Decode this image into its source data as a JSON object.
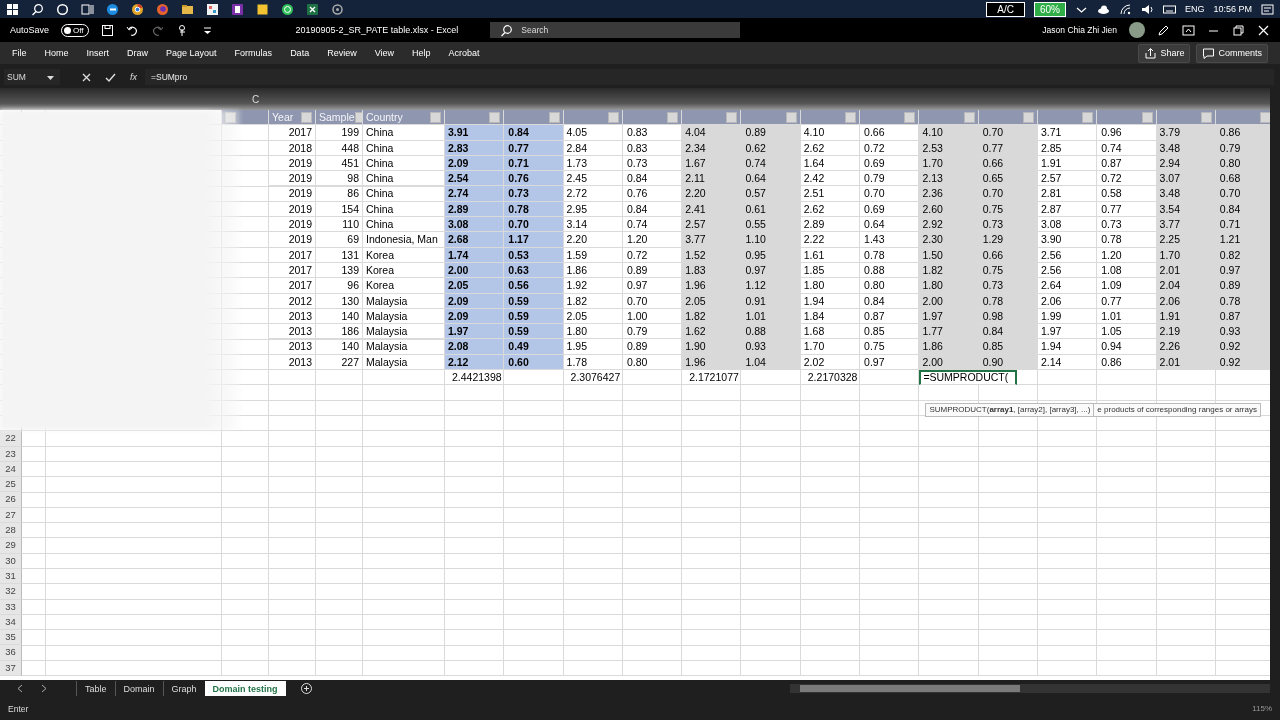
{
  "taskbar": {
    "tray": {
      "power": "A/C",
      "battery": "60%",
      "language": "ENG",
      "time": "10:56 PM"
    }
  },
  "title_bar": {
    "autosave_label": "AutoSave",
    "autosave_state": "Off",
    "autosave_on": false,
    "title": "20190905-2_SR_PATE table.xlsx  -  Excel",
    "search_placeholder": "Search",
    "user": "Jason Chia Zhi Jien"
  },
  "ribbon": {
    "tabs": [
      "File",
      "Home",
      "Insert",
      "Draw",
      "Page Layout",
      "Formulas",
      "Data",
      "Review",
      "View",
      "Help",
      "Acrobat"
    ],
    "share": "Share",
    "comments": "Comments"
  },
  "formula_bar": {
    "name_box": "SUM",
    "function_button": "fx",
    "formula": "=SUMpro"
  },
  "grid": {
    "column_letter": "C",
    "headers": [
      "Year",
      "Sample",
      "Country"
    ],
    "column_bands": [
      {
        "color": "#b4c6e7",
        "bold": true
      },
      {
        "color": "#ffffff",
        "bold": false
      },
      {
        "color": "#d9d9d9",
        "bold": false
      },
      {
        "color": "#ffffff",
        "bold": false
      },
      {
        "color": "#d9d9d9",
        "bold": false
      },
      {
        "color": "#ffffff",
        "bold": false
      },
      {
        "color": "#d9d9d9",
        "bold": false
      }
    ],
    "rows": [
      {
        "year": "2017",
        "sample": "199",
        "country": "China",
        "values": [
          "3.91",
          "0.84",
          "4.05",
          "0.83",
          "4.04",
          "0.89",
          "4.10",
          "0.66",
          "4.10",
          "0.70",
          "3.71",
          "0.96",
          "3.79",
          "0.86"
        ]
      },
      {
        "year": "2018",
        "sample": "448",
        "country": "China",
        "values": [
          "2.83",
          "0.77",
          "2.84",
          "0.83",
          "2.34",
          "0.62",
          "2.62",
          "0.72",
          "2.53",
          "0.77",
          "2.85",
          "0.74",
          "3.48",
          "0.79"
        ]
      },
      {
        "year": "2019",
        "sample": "451",
        "country": "China",
        "values": [
          "2.09",
          "0.71",
          "1.73",
          "0.73",
          "1.67",
          "0.74",
          "1.64",
          "0.69",
          "1.70",
          "0.66",
          "1.91",
          "0.87",
          "2.94",
          "0.80"
        ]
      },
      {
        "year": "2019",
        "sample": "98",
        "country": "China",
        "values": [
          "2.54",
          "0.76",
          "2.45",
          "0.84",
          "2.11",
          "0.64",
          "2.42",
          "0.79",
          "2.13",
          "0.65",
          "2.57",
          "0.72",
          "3.07",
          "0.68"
        ]
      },
      {
        "year": "2019",
        "sample": "86",
        "country": "China",
        "values": [
          "2.74",
          "0.73",
          "2.72",
          "0.76",
          "2.20",
          "0.57",
          "2.51",
          "0.70",
          "2.36",
          "0.70",
          "2.81",
          "0.58",
          "3.48",
          "0.70"
        ]
      },
      {
        "year": "2019",
        "sample": "154",
        "country": "China",
        "values": [
          "2.89",
          "0.78",
          "2.95",
          "0.84",
          "2.41",
          "0.61",
          "2.62",
          "0.69",
          "2.60",
          "0.75",
          "2.87",
          "0.77",
          "3.54",
          "0.84"
        ]
      },
      {
        "year": "2019",
        "sample": "110",
        "country": "China",
        "values": [
          "3.08",
          "0.70",
          "3.14",
          "0.74",
          "2.57",
          "0.55",
          "2.89",
          "0.64",
          "2.92",
          "0.73",
          "3.08",
          "0.73",
          "3.77",
          "0.71"
        ]
      },
      {
        "year": "2019",
        "sample": "69",
        "country": "Indonesia, Man",
        "values": [
          "2.68",
          "1.17",
          "2.20",
          "1.20",
          "3.77",
          "1.10",
          "2.22",
          "1.43",
          "2.30",
          "1.29",
          "3.90",
          "0.78",
          "2.25",
          "1.21"
        ]
      },
      {
        "year": "2017",
        "sample": "131",
        "country": "Korea",
        "values": [
          "1.74",
          "0.53",
          "1.59",
          "0.72",
          "1.52",
          "0.95",
          "1.61",
          "0.78",
          "1.50",
          "0.66",
          "2.56",
          "1.20",
          "1.70",
          "0.82"
        ]
      },
      {
        "year": "2017",
        "sample": "139",
        "country": "Korea",
        "values": [
          "2.00",
          "0.63",
          "1.86",
          "0.89",
          "1.83",
          "0.97",
          "1.85",
          "0.88",
          "1.82",
          "0.75",
          "2.56",
          "1.08",
          "2.01",
          "0.97"
        ]
      },
      {
        "year": "2017",
        "sample": "96",
        "country": "Korea",
        "values": [
          "2.05",
          "0.56",
          "1.92",
          "0.97",
          "1.96",
          "1.12",
          "1.80",
          "0.80",
          "1.80",
          "0.73",
          "2.64",
          "1.09",
          "2.04",
          "0.89"
        ]
      },
      {
        "year": "2012",
        "sample": "130",
        "country": "Malaysia",
        "values": [
          "2.09",
          "0.59",
          "1.82",
          "0.70",
          "2.05",
          "0.91",
          "1.94",
          "0.84",
          "2.00",
          "0.78",
          "2.06",
          "0.77",
          "2.06",
          "0.78"
        ]
      },
      {
        "year": "2013",
        "sample": "140",
        "country": "Malaysia",
        "values": [
          "2.09",
          "0.59",
          "2.05",
          "1.00",
          "1.82",
          "1.01",
          "1.84",
          "0.87",
          "1.97",
          "0.98",
          "1.99",
          "1.01",
          "1.91",
          "0.87"
        ]
      },
      {
        "year": "2013",
        "sample": "186",
        "country": "Malaysia",
        "values": [
          "1.97",
          "0.59",
          "1.80",
          "0.79",
          "1.62",
          "0.88",
          "1.68",
          "0.85",
          "1.77",
          "0.84",
          "1.97",
          "1.05",
          "2.19",
          "0.93"
        ]
      },
      {
        "year": "2013",
        "sample": "140",
        "country": "Malaysia",
        "values": [
          "2.08",
          "0.49",
          "1.95",
          "0.89",
          "1.90",
          "0.93",
          "1.70",
          "0.75",
          "1.86",
          "0.85",
          "1.94",
          "0.94",
          "2.26",
          "0.92"
        ]
      },
      {
        "year": "2013",
        "sample": "227",
        "country": "Malaysia",
        "values": [
          "2.12",
          "0.60",
          "1.78",
          "0.80",
          "1.96",
          "1.04",
          "2.02",
          "0.97",
          "2.00",
          "0.90",
          "2.14",
          "0.86",
          "2.01",
          "0.92"
        ]
      }
    ],
    "totals": [
      {
        "value": "2.4421398",
        "selected": false
      },
      {
        "value": "2.3076427",
        "selected": false
      },
      {
        "value": "2.1721077",
        "selected": false
      },
      {
        "value": "2.2170328",
        "selected": false
      },
      {
        "value": "=SUMPRODUCT(",
        "selected": true
      }
    ],
    "tooltip": {
      "syntax": "SUMPRODUCT(**array1**, [array2], [array3], ...)",
      "description": "e products of corresponding ranges or arrays"
    },
    "row_numbers": [
      "22",
      "23",
      "24",
      "25",
      "26",
      "27",
      "28",
      "29",
      "30",
      "31",
      "32",
      "33",
      "34",
      "35",
      "36",
      "37"
    ]
  },
  "sheet_tabs": [
    {
      "label": "Table",
      "selected": false
    },
    {
      "label": "Domain",
      "selected": false
    },
    {
      "label": "Graph",
      "selected": false
    },
    {
      "label": "Domain testing",
      "selected": true
    }
  ],
  "status_bar": {
    "mode": "Enter",
    "zoom": "115%"
  }
}
